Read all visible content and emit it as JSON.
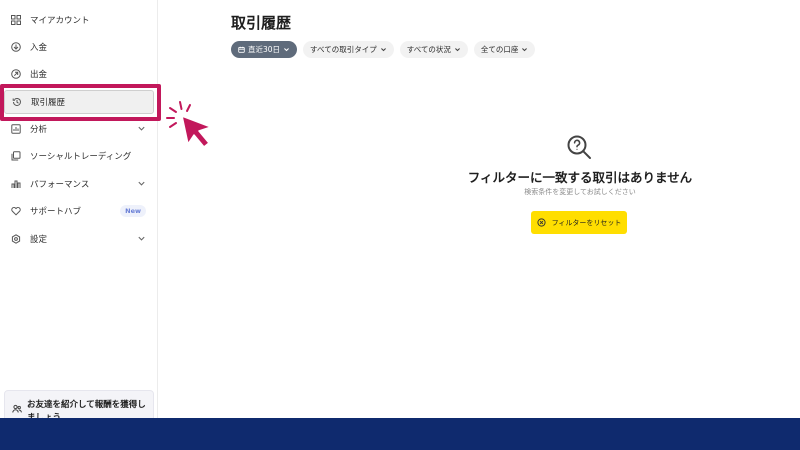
{
  "sidebar": {
    "items": [
      {
        "label": "マイアカウント",
        "icon": "grid-icon"
      },
      {
        "label": "入金",
        "icon": "deposit-icon"
      },
      {
        "label": "出金",
        "icon": "withdraw-icon"
      },
      {
        "label": "取引履歴",
        "icon": "history-icon",
        "active": true
      },
      {
        "label": "分析",
        "icon": "analytics-icon",
        "expandable": true
      },
      {
        "label": "ソーシャルトレーディング",
        "icon": "social-trading-icon"
      },
      {
        "label": "パフォーマンス",
        "icon": "performance-icon",
        "expandable": true
      },
      {
        "label": "サポートハブ",
        "icon": "heart-icon",
        "badge": "New"
      },
      {
        "label": "設定",
        "icon": "settings-icon",
        "expandable": true
      }
    ],
    "referral_text": "お友達を紹介して報酬を獲得しましょう"
  },
  "main": {
    "title": "取引履歴",
    "filters": [
      {
        "label": "直近30日",
        "selected": true
      },
      {
        "label": "すべての取引タイプ"
      },
      {
        "label": "すべての状況"
      },
      {
        "label": "全ての口座"
      }
    ],
    "empty_state": {
      "title": "フィルターに一致する取引はありません",
      "subtitle": "検索条件を変更してお試しください",
      "reset_label": "フィルターをリセット"
    }
  },
  "colors": {
    "highlight": "#c2185b",
    "accent_yellow": "#ffde00",
    "bottom_bar": "#0f2a6e",
    "chip_selected": "#5f6b7b"
  }
}
